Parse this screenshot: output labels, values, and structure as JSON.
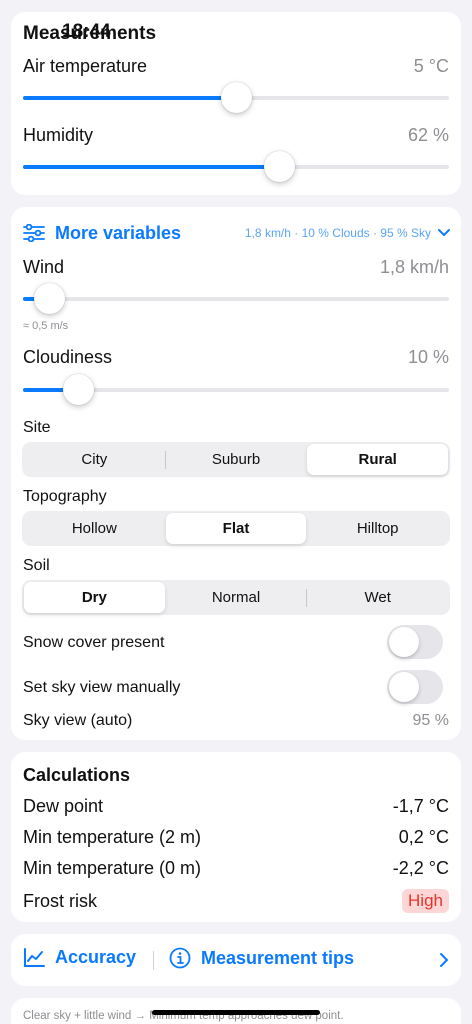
{
  "status_bar": {
    "time": "18:44"
  },
  "measurements": {
    "title": "Measurements",
    "air_temperature": {
      "label": "Air temperature",
      "value": "5 °C",
      "fraction": 0.5
    },
    "humidity": {
      "label": "Humidity",
      "value": "62 %",
      "fraction": 0.6
    }
  },
  "more": {
    "title": "More variables",
    "summary": "1,8 km/h · 10 % Clouds · 95 % Sky",
    "wind": {
      "label": "Wind",
      "value": "1,8 km/h",
      "sub": "≈ 0,5 m/s",
      "fraction": 0.06
    },
    "cloudiness": {
      "label": "Cloudiness",
      "value": "10 %",
      "fraction": 0.13
    },
    "site": {
      "label": "Site",
      "options": [
        "City",
        "Suburb",
        "Rural"
      ],
      "selected": 2
    },
    "topography": {
      "label": "Topography",
      "options": [
        "Hollow",
        "Flat",
        "Hilltop"
      ],
      "selected": 1
    },
    "soil": {
      "label": "Soil",
      "options": [
        "Dry",
        "Normal",
        "Wet"
      ],
      "selected": 0
    },
    "snow_cover": {
      "label": "Snow cover present",
      "on": false
    },
    "sky_manual": {
      "label": "Set sky view manually",
      "on": false
    },
    "sky_view": {
      "label": "Sky view (auto)",
      "value": "95 %"
    }
  },
  "calculations": {
    "title": "Calculations",
    "dew_point": {
      "label": "Dew point",
      "value": "-1,7 °C"
    },
    "min_temp_2m": {
      "label": "Min temperature (2 m)",
      "value": "0,2 °C"
    },
    "min_temp_0m": {
      "label": "Min temperature (0 m)",
      "value": "-2,2 °C"
    },
    "frost_risk": {
      "label": "Frost risk",
      "value": "High"
    }
  },
  "links": {
    "accuracy": "Accuracy",
    "tips": "Measurement tips"
  },
  "footer": {
    "text": "Clear sky + little wind → Minimum temp approaches dew point."
  },
  "colors": {
    "accent": "#0A7AFF",
    "danger": "#E5352B",
    "danger_bg": "#FFD6D6"
  }
}
